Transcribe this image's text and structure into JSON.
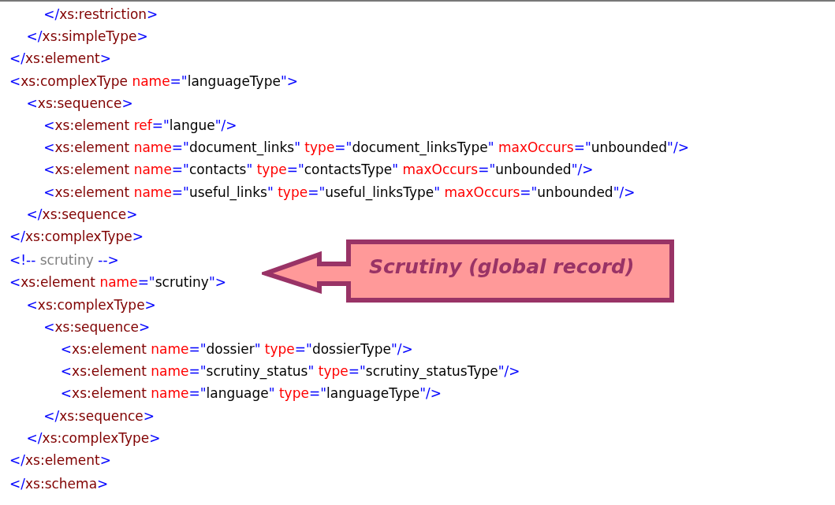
{
  "code_blocks": [
    {
      "lines": [
        {
          "tokens": [
            {
              "kind": "punct",
              "text": "        </"
            },
            {
              "kind": "tag",
              "text": "xs:restriction"
            },
            {
              "kind": "punct",
              "text": ">"
            }
          ]
        },
        {
          "tokens": [
            {
              "kind": "punct",
              "text": "    </"
            },
            {
              "kind": "tag",
              "text": "xs:simpleType"
            },
            {
              "kind": "punct",
              "text": ">"
            }
          ]
        },
        {
          "tokens": [
            {
              "kind": "punct",
              "text": "</"
            },
            {
              "kind": "tag",
              "text": "xs:element"
            },
            {
              "kind": "punct",
              "text": ">"
            }
          ]
        },
        {
          "tokens": [
            {
              "kind": "punct",
              "text": "<"
            },
            {
              "kind": "tag",
              "text": "xs:complexType"
            },
            {
              "kind": "attr",
              "text": " name"
            },
            {
              "kind": "punct",
              "text": "=\""
            },
            {
              "kind": "value",
              "text": "languageType"
            },
            {
              "kind": "punct",
              "text": "\">"
            }
          ]
        },
        {
          "tokens": [
            {
              "kind": "punct",
              "text": "    <"
            },
            {
              "kind": "tag",
              "text": "xs:sequence"
            },
            {
              "kind": "punct",
              "text": ">"
            }
          ]
        },
        {
          "tokens": [
            {
              "kind": "punct",
              "text": "        <"
            },
            {
              "kind": "tag",
              "text": "xs:element"
            },
            {
              "kind": "attr",
              "text": " ref"
            },
            {
              "kind": "punct",
              "text": "=\""
            },
            {
              "kind": "value",
              "text": "langue"
            },
            {
              "kind": "punct",
              "text": "\"/>"
            }
          ]
        },
        {
          "tokens": [
            {
              "kind": "punct",
              "text": "        <"
            },
            {
              "kind": "tag",
              "text": "xs:element"
            },
            {
              "kind": "attr",
              "text": " name"
            },
            {
              "kind": "punct",
              "text": "=\""
            },
            {
              "kind": "value",
              "text": "document_links"
            },
            {
              "kind": "punct",
              "text": "\""
            },
            {
              "kind": "attr",
              "text": " type"
            },
            {
              "kind": "punct",
              "text": "=\""
            },
            {
              "kind": "value",
              "text": "document_linksType"
            },
            {
              "kind": "punct",
              "text": "\""
            },
            {
              "kind": "attr",
              "text": " maxOccurs"
            },
            {
              "kind": "punct",
              "text": "=\""
            },
            {
              "kind": "value",
              "text": "unbounded"
            },
            {
              "kind": "punct",
              "text": "\"/>"
            }
          ]
        },
        {
          "tokens": [
            {
              "kind": "punct",
              "text": "        <"
            },
            {
              "kind": "tag",
              "text": "xs:element"
            },
            {
              "kind": "attr",
              "text": " name"
            },
            {
              "kind": "punct",
              "text": "=\""
            },
            {
              "kind": "value",
              "text": "contacts"
            },
            {
              "kind": "punct",
              "text": "\""
            },
            {
              "kind": "attr",
              "text": " type"
            },
            {
              "kind": "punct",
              "text": "=\""
            },
            {
              "kind": "value",
              "text": "contactsType"
            },
            {
              "kind": "punct",
              "text": "\""
            },
            {
              "kind": "attr",
              "text": " maxOccurs"
            },
            {
              "kind": "punct",
              "text": "=\""
            },
            {
              "kind": "value",
              "text": "unbounded"
            },
            {
              "kind": "punct",
              "text": "\"/>"
            }
          ]
        },
        {
          "tokens": [
            {
              "kind": "punct",
              "text": "        <"
            },
            {
              "kind": "tag",
              "text": "xs:element"
            },
            {
              "kind": "attr",
              "text": " name"
            },
            {
              "kind": "punct",
              "text": "=\""
            },
            {
              "kind": "value",
              "text": "useful_links"
            },
            {
              "kind": "punct",
              "text": "\""
            },
            {
              "kind": "attr",
              "text": " type"
            },
            {
              "kind": "punct",
              "text": "=\""
            },
            {
              "kind": "value",
              "text": "useful_linksType"
            },
            {
              "kind": "punct",
              "text": "\""
            },
            {
              "kind": "attr",
              "text": " maxOccurs"
            },
            {
              "kind": "punct",
              "text": "=\""
            },
            {
              "kind": "value",
              "text": "unbounded"
            },
            {
              "kind": "punct",
              "text": "\"/>"
            }
          ]
        },
        {
          "tokens": [
            {
              "kind": "punct",
              "text": "    </"
            },
            {
              "kind": "tag",
              "text": "xs:sequence"
            },
            {
              "kind": "punct",
              "text": ">"
            }
          ]
        },
        {
          "tokens": [
            {
              "kind": "punct",
              "text": "</"
            },
            {
              "kind": "tag",
              "text": "xs:complexType"
            },
            {
              "kind": "punct",
              "text": ">"
            }
          ]
        }
      ]
    },
    {
      "lines": [
        {
          "tokens": [
            {
              "kind": "punct",
              "text": "<!--"
            },
            {
              "kind": "comment",
              "text": " scrutiny "
            },
            {
              "kind": "punct",
              "text": "-->"
            }
          ]
        },
        {
          "tokens": [
            {
              "kind": "punct",
              "text": "<"
            },
            {
              "kind": "tag",
              "text": "xs:element"
            },
            {
              "kind": "attr",
              "text": " name"
            },
            {
              "kind": "punct",
              "text": "=\""
            },
            {
              "kind": "value",
              "text": "scrutiny"
            },
            {
              "kind": "punct",
              "text": "\">"
            }
          ]
        },
        {
          "tokens": [
            {
              "kind": "punct",
              "text": "    <"
            },
            {
              "kind": "tag",
              "text": "xs:complexType"
            },
            {
              "kind": "punct",
              "text": ">"
            }
          ]
        },
        {
          "tokens": [
            {
              "kind": "punct",
              "text": "        <"
            },
            {
              "kind": "tag",
              "text": "xs:sequence"
            },
            {
              "kind": "punct",
              "text": ">"
            }
          ]
        },
        {
          "tokens": [
            {
              "kind": "punct",
              "text": "            <"
            },
            {
              "kind": "tag",
              "text": "xs:element"
            },
            {
              "kind": "attr",
              "text": " name"
            },
            {
              "kind": "punct",
              "text": "=\""
            },
            {
              "kind": "value",
              "text": "dossier"
            },
            {
              "kind": "punct",
              "text": "\""
            },
            {
              "kind": "attr",
              "text": " type"
            },
            {
              "kind": "punct",
              "text": "=\""
            },
            {
              "kind": "value",
              "text": "dossierType"
            },
            {
              "kind": "punct",
              "text": "\"/>"
            }
          ]
        },
        {
          "tokens": [
            {
              "kind": "punct",
              "text": "            <"
            },
            {
              "kind": "tag",
              "text": "xs:element"
            },
            {
              "kind": "attr",
              "text": " name"
            },
            {
              "kind": "punct",
              "text": "=\""
            },
            {
              "kind": "value",
              "text": "scrutiny_status"
            },
            {
              "kind": "punct",
              "text": "\""
            },
            {
              "kind": "attr",
              "text": " type"
            },
            {
              "kind": "punct",
              "text": "=\""
            },
            {
              "kind": "value",
              "text": "scrutiny_statusType"
            },
            {
              "kind": "punct",
              "text": "\"/>"
            }
          ]
        },
        {
          "tokens": [
            {
              "kind": "punct",
              "text": "            <"
            },
            {
              "kind": "tag",
              "text": "xs:element"
            },
            {
              "kind": "attr",
              "text": " name"
            },
            {
              "kind": "punct",
              "text": "=\""
            },
            {
              "kind": "value",
              "text": "language"
            },
            {
              "kind": "punct",
              "text": "\""
            },
            {
              "kind": "attr",
              "text": " type"
            },
            {
              "kind": "punct",
              "text": "=\""
            },
            {
              "kind": "value",
              "text": "languageType"
            },
            {
              "kind": "punct",
              "text": "\"/>"
            }
          ]
        },
        {
          "tokens": [
            {
              "kind": "punct",
              "text": "        </"
            },
            {
              "kind": "tag",
              "text": "xs:sequence"
            },
            {
              "kind": "punct",
              "text": ">"
            }
          ]
        },
        {
          "tokens": [
            {
              "kind": "punct",
              "text": "    </"
            },
            {
              "kind": "tag",
              "text": "xs:complexType"
            },
            {
              "kind": "punct",
              "text": ">"
            }
          ]
        },
        {
          "tokens": [
            {
              "kind": "punct",
              "text": "</"
            },
            {
              "kind": "tag",
              "text": "xs:element"
            },
            {
              "kind": "punct",
              "text": ">"
            }
          ]
        }
      ]
    },
    {
      "lines": [
        {
          "tokens": [
            {
              "kind": "punct",
              "text": "</"
            },
            {
              "kind": "tag",
              "text": "xs:schema"
            },
            {
              "kind": "punct",
              "text": ">"
            }
          ]
        }
      ]
    }
  ],
  "callout": {
    "text": "Scrutiny (global record)"
  }
}
